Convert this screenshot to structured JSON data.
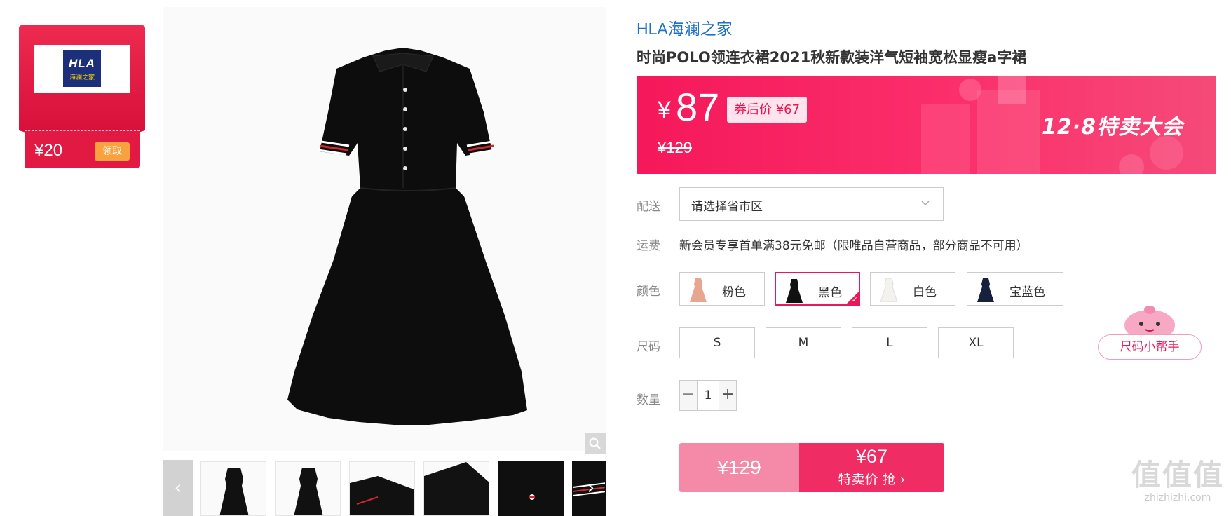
{
  "coupon": {
    "logo_line1": "HLA",
    "logo_line2": "海澜之家",
    "amount": "¥20",
    "claim_label": "领取"
  },
  "gallery": {
    "prev_arrow": "‹",
    "next_arrow": "›",
    "zoom_icon": "search-icon"
  },
  "product": {
    "brand": "HLA海澜之家",
    "title": "时尚POLO领连衣裙2021秋新款装洋气短袖宽松显瘦a字裙"
  },
  "price": {
    "currency": "¥",
    "current": "87",
    "coupon_price": "券后价 ¥67",
    "original": "¥129",
    "promo": "12·8特卖大会"
  },
  "delivery": {
    "label": "配送",
    "placeholder": "请选择省市区"
  },
  "shipping": {
    "label": "运费",
    "text": "新会员专享首单满38元免邮（限唯品自营商品，部分商品不可用）"
  },
  "colors": {
    "label": "颜色",
    "options": [
      {
        "name": "粉色",
        "swatch": "#e8a58f"
      },
      {
        "name": "黑色",
        "swatch": "#111111"
      },
      {
        "name": "白色",
        "swatch": "#f4f2ee"
      },
      {
        "name": "宝蓝色",
        "swatch": "#15213d"
      }
    ],
    "selected": "黑色"
  },
  "sizes": {
    "label": "尺码",
    "options": [
      "S",
      "M",
      "L",
      "XL"
    ]
  },
  "quantity": {
    "label": "数量",
    "minus": "−",
    "value": "1",
    "plus": "+"
  },
  "buy": {
    "original": "¥129",
    "price": "¥67",
    "label": "特卖价 抢 ›"
  },
  "size_helper": {
    "label": "尺码小帮手"
  },
  "watermark": {
    "main": "值值值",
    "sub": "zhizhizhi.com"
  },
  "colors_theme": {
    "accent": "#e8195a",
    "brand_blue": "#1d6fc8",
    "banner_pink": "#f5185a"
  }
}
